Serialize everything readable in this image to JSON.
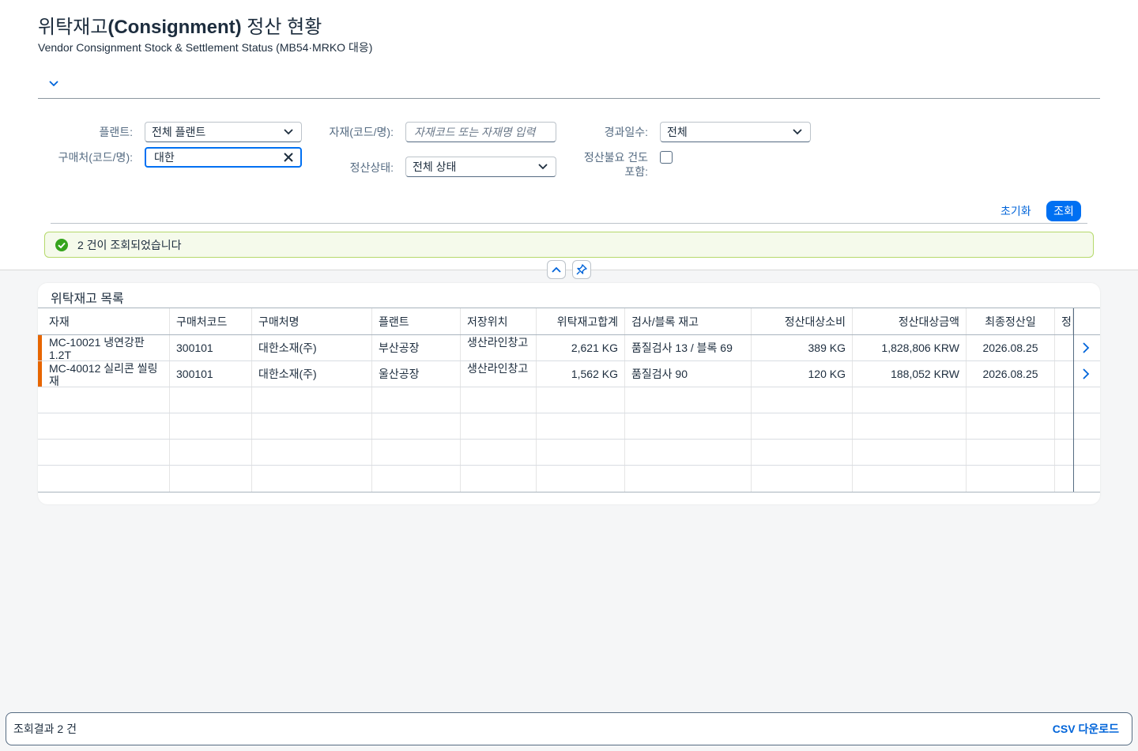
{
  "page": {
    "title_main": "위탁재고",
    "title_bold": "(Consignment)",
    "title_tail": " 정산 현황",
    "subtitle": "Vendor Consignment Stock & Settlement Status (MB54·MRKO 대응)"
  },
  "filters": {
    "plant": {
      "label": "플랜트:",
      "value": "전체 플랜트"
    },
    "material": {
      "label": "자재(코드/명):",
      "placeholder": "자재코드 또는 자재명 입력"
    },
    "elapsed": {
      "label": "경과일수:",
      "value": "전체"
    },
    "vendor": {
      "label": "구매처(코드/명):",
      "value": "대한"
    },
    "status": {
      "label": "정산상태:",
      "value": "전체 상태"
    },
    "include_unsettled": {
      "label": "정산불요 건도 포함:",
      "checked": false
    }
  },
  "actions": {
    "reset": "초기화",
    "search": "조회"
  },
  "message": {
    "text": "2 건이 조회되었습니다",
    "type": "success"
  },
  "table": {
    "title": "위탁재고 목록",
    "columns": [
      "자재",
      "구매처코드",
      "구매처명",
      "플랜트",
      "저장위치",
      "위탁재고합계",
      "검사/블록 재고",
      "정산대상소비",
      "정산대상금액",
      "최종정산일",
      "정"
    ],
    "rows": [
      {
        "material": "MC-10021 냉연강판 1.2T",
        "vendor_code": "300101",
        "vendor_name": "대한소재(주)",
        "plant": "부산공장",
        "storage": "생산라인창고",
        "total": "2,621 KG",
        "inspection": "품질검사 13 / 블록 69",
        "consumption": "389 KG",
        "amount": "1,828,806 KRW",
        "last_date": "2026.08.25"
      },
      {
        "material": "MC-40012 실리콘 씰링재",
        "vendor_code": "300101",
        "vendor_name": "대한소재(주)",
        "plant": "울산공장",
        "storage": "생산라인창고",
        "total": "1,562 KG",
        "inspection": "품질검사 90",
        "consumption": "120 KG",
        "amount": "188,052 KRW",
        "last_date": "2026.08.25"
      }
    ]
  },
  "footer": {
    "count": "조회결과 2 건",
    "csv": "CSV 다운로드"
  },
  "colors": {
    "accent": "#0070f2",
    "row_marker": "#e76500",
    "success": "#36a41d"
  },
  "icons": [
    "chevron-down-icon",
    "clear-icon",
    "success-icon",
    "chevron-up-icon",
    "pin-icon",
    "chevron-right-icon"
  ]
}
